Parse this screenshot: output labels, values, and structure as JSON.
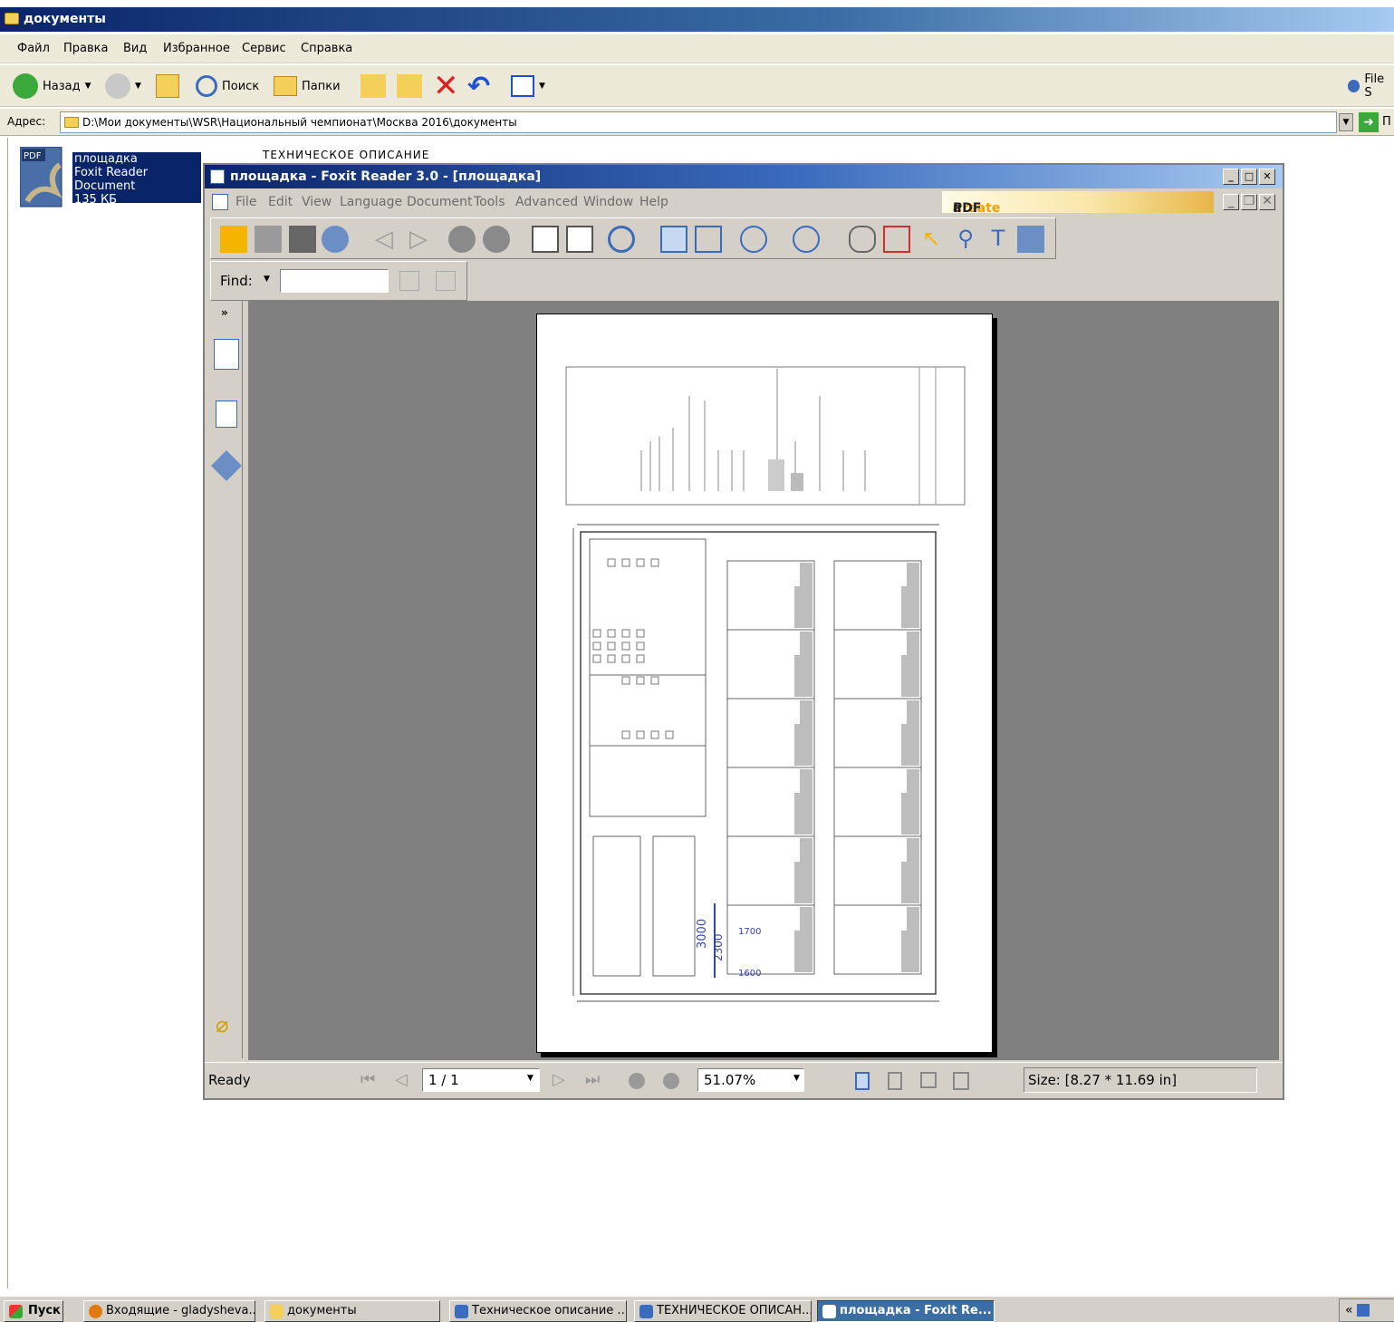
{
  "explorer": {
    "title": "документы",
    "menu": [
      "Файл",
      "Правка",
      "Вид",
      "Избранное",
      "Сервис",
      "Справка"
    ],
    "toolbar": {
      "back": "Назад",
      "search": "Поиск",
      "folders": "Папки",
      "file_s": "File S"
    },
    "address_label": "Адрес:",
    "address": "D:\\Мои документы\\WSR\\Национальный чемпионат\\Москва 2016\\документы",
    "go_label": "П"
  },
  "file_item": {
    "name": "площадка",
    "type": "Foxit Reader Document",
    "size": "135 КБ",
    "behind_label": "ТЕХНИЧЕСКОЕ ОПИСАНИЕ"
  },
  "foxit": {
    "title": "площадка - Foxit Reader 3.0 - [площадка]",
    "menu": [
      "File",
      "Edit",
      "View",
      "Language",
      "Document",
      "Tools",
      "Advanced",
      "Window",
      "Help"
    ],
    "create_pdf": {
      "part1": "Create",
      "part2": "a",
      "part3": "PDF"
    },
    "find_label": "Find:",
    "status": {
      "ready": "Ready",
      "page": "1 / 1",
      "zoom": "51.07%",
      "size": "Size: [8.27 * 11.69 in]"
    },
    "handwritten": [
      "3000",
      "2300",
      "1700",
      "1600"
    ]
  },
  "taskbar": {
    "start": "Пуск",
    "items": [
      "Входящие - gladysheva...",
      "документы",
      "Техническое описание ...",
      "ТЕХНИЧЕСКОЕ ОПИСАН...",
      "площадка - Foxit Re..."
    ],
    "tray": "«"
  },
  "colors": {
    "title_blue": "#0a246a",
    "face": "#d4d0c8",
    "doc_bg": "#808080"
  }
}
